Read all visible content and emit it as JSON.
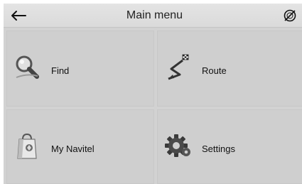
{
  "header": {
    "title": "Main menu",
    "back_icon": "left-arrow-icon",
    "status_icon": "gps-off-icon"
  },
  "menu": {
    "items": [
      {
        "label": "Find",
        "icon": "magnifier-icon"
      },
      {
        "label": "Route",
        "icon": "route-flag-icon"
      },
      {
        "label": "My Navitel",
        "icon": "shopping-bag-icon"
      },
      {
        "label": "Settings",
        "icon": "gear-icon"
      }
    ]
  },
  "colors": {
    "background": "#d2d2d2",
    "tile": "#cfcfcf",
    "text": "#111111"
  }
}
